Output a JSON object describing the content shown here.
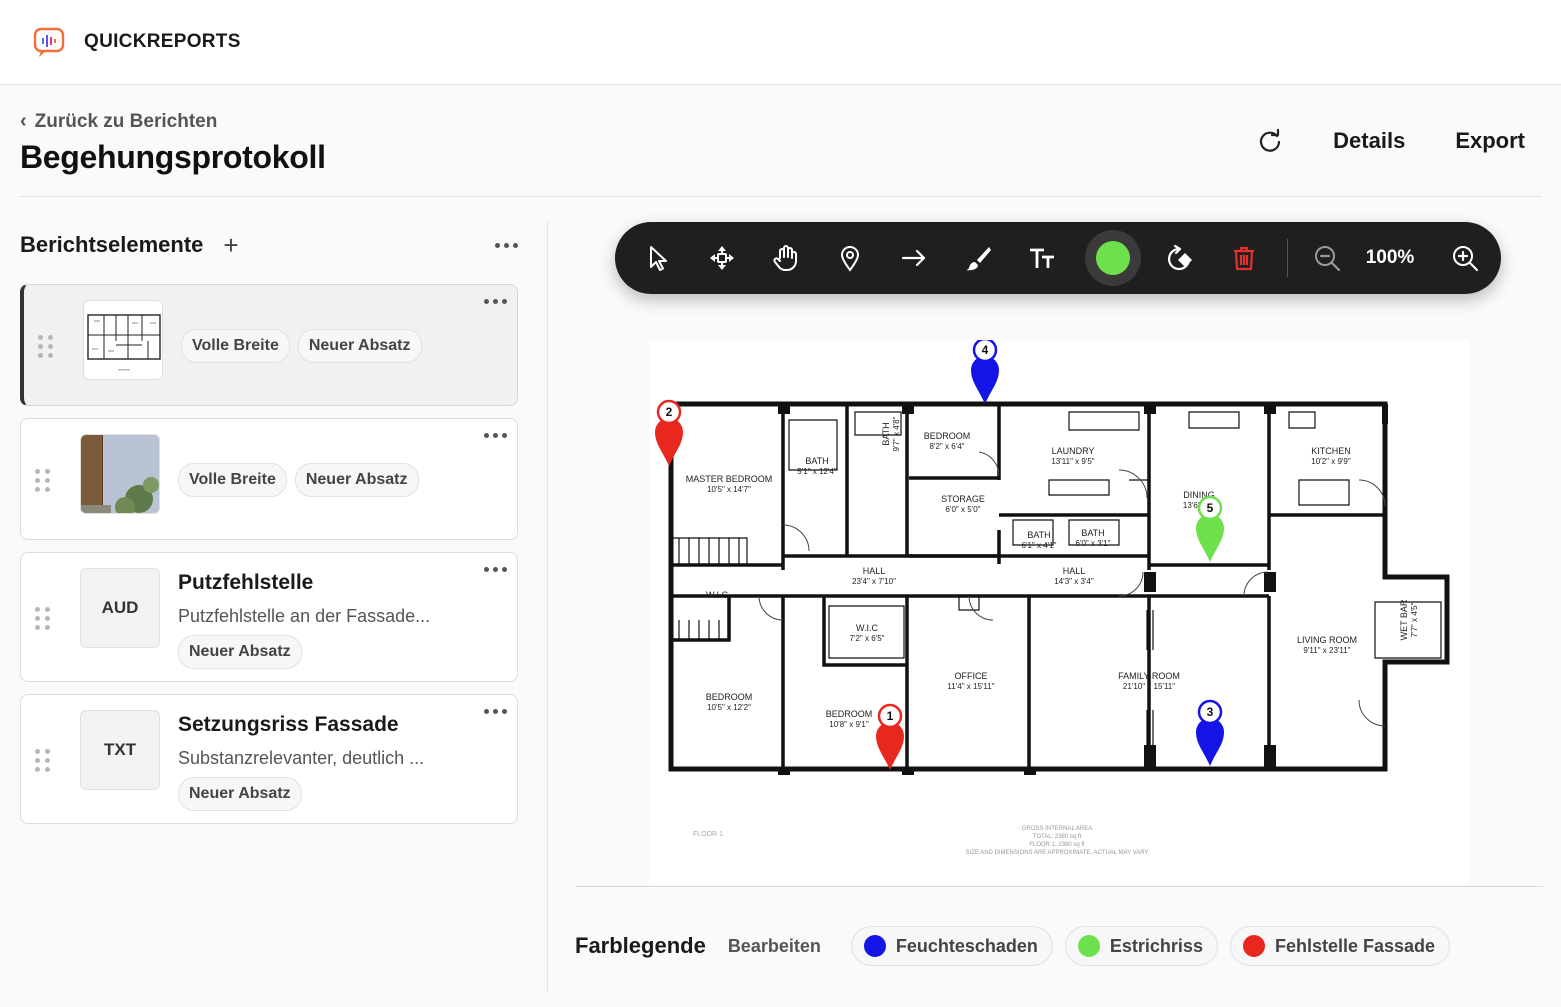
{
  "app": {
    "brand": "QUICKREPORTS"
  },
  "header": {
    "back_label": "Zurück zu Berichten",
    "title": "Begehungsprotokoll",
    "details_label": "Details",
    "export_label": "Export"
  },
  "sidebar": {
    "title": "Berichtselemente",
    "items": [
      {
        "thumb": "floorplan",
        "chips": [
          "Volle Breite",
          "Neuer Absatz"
        ]
      },
      {
        "thumb": "photo",
        "chips": [
          "Volle Breite",
          "Neuer Absatz"
        ]
      },
      {
        "tag": "AUD",
        "title": "Putzfehlstelle",
        "desc": "Putzfehlstelle an der Fassade...",
        "chips": [
          "Neuer Absatz"
        ]
      },
      {
        "tag": "TXT",
        "title": "Setzungsriss Fassade",
        "desc": "Substanzrelevanter, deutlich ...",
        "chips": [
          "Neuer Absatz"
        ]
      }
    ]
  },
  "toolbar": {
    "tools": [
      "select-icon",
      "move-icon",
      "pan-icon",
      "pin-icon",
      "arrow-icon",
      "brush-icon",
      "text-size-icon",
      "color-picker",
      "rotate-icon",
      "delete-icon",
      "zoom-out-icon",
      "zoom-in-icon"
    ],
    "active_color": "#6ee04b",
    "zoom": "100%"
  },
  "floorplan": {
    "rooms": [
      {
        "name": "MASTER BEDROOM",
        "dim": "10'5\" x 14'7\""
      },
      {
        "name": "BATH",
        "dim": "5'1\" x 12'4\""
      },
      {
        "name": "BATH",
        "dim": "9'7\" x 4'8\""
      },
      {
        "name": "BEDROOM",
        "dim": "8'2\" x 6'4\""
      },
      {
        "name": "STORAGE",
        "dim": "6'0\" x 5'0\""
      },
      {
        "name": "LAUNDRY",
        "dim": "13'11\" x 9'5\""
      },
      {
        "name": "BATH",
        "dim": "6'1\" x 4'1\""
      },
      {
        "name": "BATH",
        "dim": "6'0\" x 3'1\""
      },
      {
        "name": "DINING",
        "dim": "13'6\" x 9'"
      },
      {
        "name": "KITCHEN",
        "dim": "10'2\" x 9'9\""
      },
      {
        "name": "HALL",
        "dim": "23'4\" x 7'10\""
      },
      {
        "name": "HALL",
        "dim": "14'3\" x 3'4\""
      },
      {
        "name": "W.I.C",
        "dim": ""
      },
      {
        "name": "W.I.C",
        "dim": "7'2\" x 6'5\""
      },
      {
        "name": "BEDROOM",
        "dim": "10'5\" x 12'2\""
      },
      {
        "name": "BEDROOM",
        "dim": "10'8\" x 9'1\""
      },
      {
        "name": "OFFICE",
        "dim": "11'4\" x 15'11\""
      },
      {
        "name": "FAMILY ROOM",
        "dim": "21'10\" x 15'11\""
      },
      {
        "name": "LIVING ROOM",
        "dim": "9'11\" x 23'11\""
      },
      {
        "name": "WET BAR",
        "dim": "7'7\" x 4'5\""
      }
    ],
    "floor_label": "FLOOR 1",
    "area_notes": [
      "GROSS INTERNAL AREA",
      "TOTAL: 2380 sq ft",
      "FLOOR 1: 2380 sq ft",
      "SIZE AND DIMENSIONS ARE APPROXIMATE, ACTUAL MAY VARY"
    ],
    "markers": [
      {
        "label": "1",
        "color": "#e8281f"
      },
      {
        "label": "2",
        "color": "#e8281f"
      },
      {
        "label": "3",
        "color": "#1414e6"
      },
      {
        "label": "4",
        "color": "#1414e6"
      },
      {
        "label": "5",
        "color": "#6ee04b"
      }
    ]
  },
  "legend": {
    "title": "Farblegende",
    "edit_label": "Bearbeiten",
    "items": [
      {
        "label": "Feuchteschaden",
        "color": "#1414e6"
      },
      {
        "label": "Estrichriss",
        "color": "#6ee04b"
      },
      {
        "label": "Fehlstelle Fassade",
        "color": "#e8281f"
      }
    ]
  }
}
